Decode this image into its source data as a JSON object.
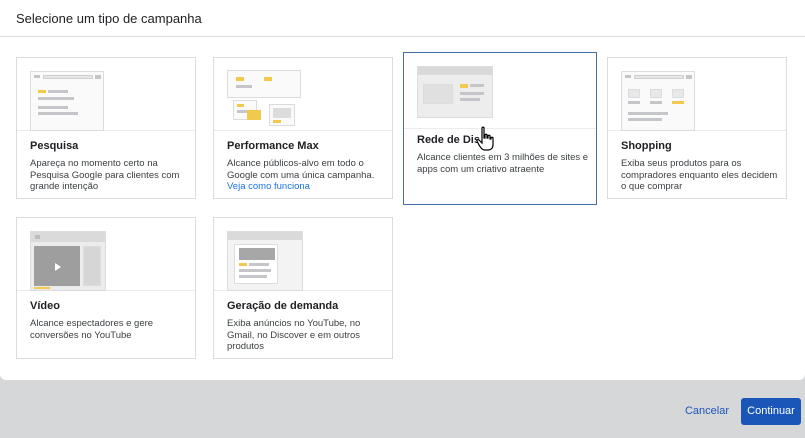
{
  "dialog": {
    "title": "Selecione um tipo de campanha"
  },
  "cards": [
    {
      "id": "search",
      "title": "Pesquisa",
      "desc": "Apareça no momento certo na Pesquisa Google para clientes com grande intenção"
    },
    {
      "id": "pmax",
      "title": "Performance Max",
      "desc": "Alcance públicos-alvo em todo o Google com uma única campanha.",
      "link": "Veja como funciona"
    },
    {
      "id": "display",
      "title": "Rede de Dis",
      "desc": "Alcance clientes em 3 milhões de sites e apps com um criativo atraente",
      "selected": true
    },
    {
      "id": "shopping",
      "title": "Shopping",
      "desc": "Exiba seus produtos para os compradores enquanto eles decidem o que comprar"
    },
    {
      "id": "video",
      "title": "Vídeo",
      "desc": "Alcance espectadores e gere conversões no YouTube"
    },
    {
      "id": "demand",
      "title": "Geração de demanda",
      "desc": "Exiba anúncios no YouTube, no Gmail, no Discover e em outros produtos"
    }
  ],
  "footer": {
    "cancel_label": "Cancelar",
    "continue_label": "Continuar"
  },
  "colors": {
    "accent": "#1a56b8",
    "selected_border": "#4a6fa5",
    "thumb_yellow": "#f2c94c"
  }
}
